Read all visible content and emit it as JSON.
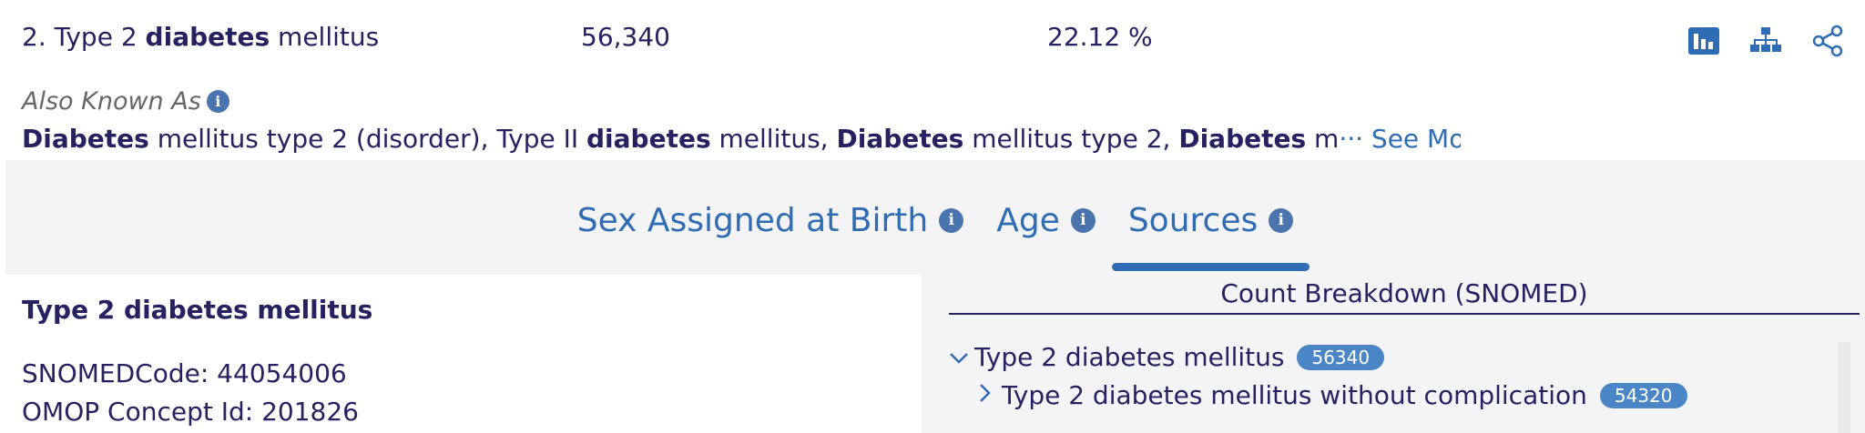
{
  "result": {
    "name_prefix": "2. Type 2 ",
    "name_bold": "diabetes",
    "name_suffix": " mellitus",
    "count": "56,340",
    "percentage": "22.12 %",
    "actions": [
      {
        "icon": "bar-chart-icon"
      },
      {
        "icon": "hierarchy-icon"
      },
      {
        "icon": "share-icon"
      }
    ]
  },
  "also_known_as": {
    "label": "Also Known As",
    "segments": [
      {
        "b": "Diabetes",
        "t": " mellitus type 2 (disorder), Type II "
      },
      {
        "b": "diabetes",
        "t": " mellitus, "
      },
      {
        "b": "Diabetes",
        "t": " mellitus type 2, "
      },
      {
        "b": "Diabetes",
        "t": " m"
      }
    ],
    "ellipsis": "···",
    "see_more": " See More"
  },
  "tabs": [
    {
      "label": "Sex Assigned at Birth",
      "active": false
    },
    {
      "label": "Age",
      "active": false
    },
    {
      "label": "Sources",
      "active": true
    }
  ],
  "details": {
    "title": "Type 2 diabetes mellitus",
    "snomed": "SNOMEDCode: 44054006",
    "omop": "OMOP Concept Id: 201826"
  },
  "breakdown": {
    "title": "Count Breakdown (SNOMED)",
    "nodes": [
      {
        "label": "Type 2 diabetes mellitus",
        "count": "56340",
        "expanded": true
      },
      {
        "label": "Type 2 diabetes mellitus without complication",
        "count": "54320",
        "expanded": false
      }
    ]
  },
  "colors": {
    "navy": "#262262",
    "link_blue": "#2e6db4",
    "badge_blue": "#4a86c5",
    "panel_gray": "#f4f4f6"
  }
}
